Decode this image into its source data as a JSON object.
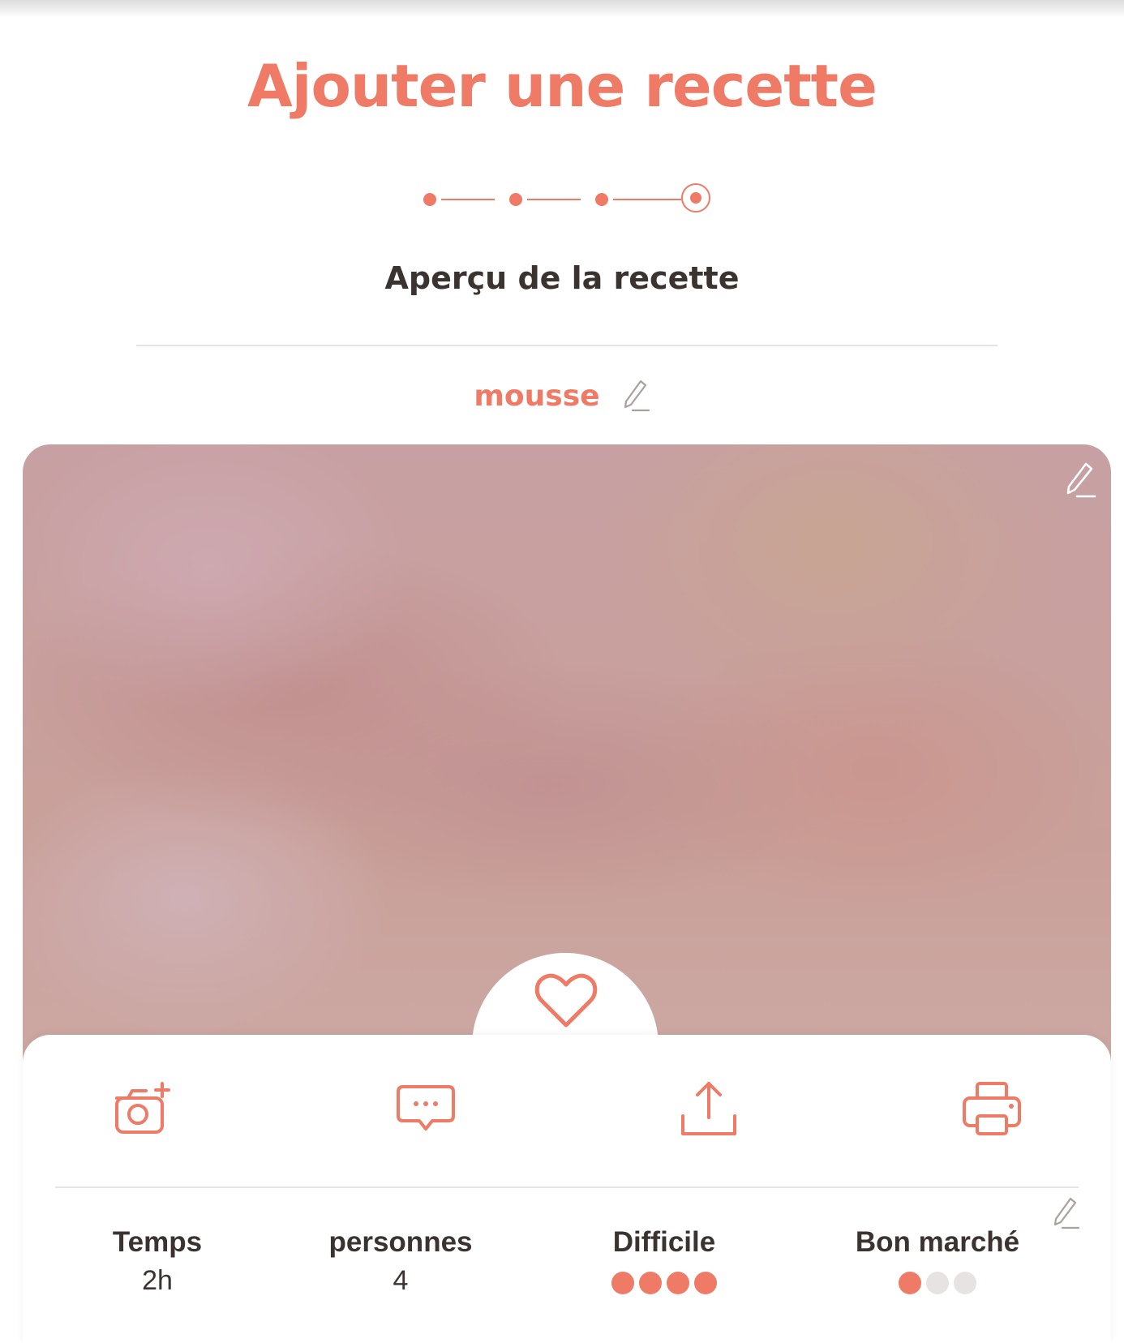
{
  "page": {
    "title": "Ajouter une recette",
    "subtitle": "Aperçu de la recette"
  },
  "stepper": {
    "total_steps": 4,
    "current_step": 4
  },
  "recipe": {
    "name": "mousse"
  },
  "colors": {
    "accent": "#ef7a66",
    "text": "#3a3330",
    "divider": "#e6e3e1",
    "dot_inactive": "#e7e3e2"
  },
  "icons": {
    "edit": "pencil-icon",
    "favorite": "heart-icon",
    "add_photo": "camera-plus-icon",
    "comment": "chat-bubble-icon",
    "share": "share-upload-icon",
    "print": "printer-icon"
  },
  "info": {
    "time": {
      "label": "Temps",
      "value": "2h"
    },
    "servings": {
      "label": "personnes",
      "value": "4"
    },
    "difficulty": {
      "label": "Difficile",
      "level": 4,
      "max": 4
    },
    "cost": {
      "label": "Bon marché",
      "level": 1,
      "max": 3
    }
  }
}
